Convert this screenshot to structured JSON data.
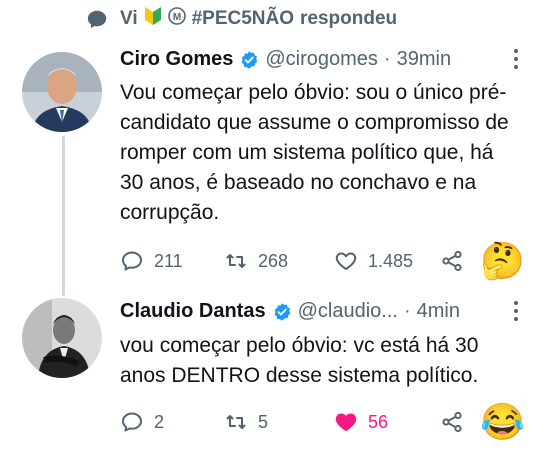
{
  "context": {
    "user": "Vi",
    "hashtag": "#PEC5NÃO",
    "action": "respondeu"
  },
  "tweets": [
    {
      "name": "Ciro Gomes",
      "handle": "@cirogomes",
      "separator": "·",
      "time": "39min",
      "text": "Vou começar pelo óbvio: sou o único pré-candidato que assume o compromisso de romper com um sistema político que, há 30 anos, é baseado no conchavo e na corrupção.",
      "replies": "211",
      "retweets": "268",
      "likes": "1.485",
      "liked": false,
      "reaction_emoji": "🤔"
    },
    {
      "name": "Claudio Dantas",
      "handle": "@claudio...",
      "separator": "·",
      "time": "4min",
      "text": "vou começar pelo óbvio: vc está há 30 anos DENTRO desse sistema político.",
      "replies": "2",
      "retweets": "5",
      "likes": "56",
      "liked": true,
      "reaction_emoji": "😂"
    }
  ],
  "colors": {
    "verified": "#1d9bf0",
    "like_active": "#f91880",
    "secondary_text": "#536471",
    "thread_line": "#cfd9de"
  },
  "icons": [
    "comment-icon",
    "retweet-icon",
    "heart-icon",
    "share-icon",
    "verified-icon",
    "more-icon"
  ]
}
